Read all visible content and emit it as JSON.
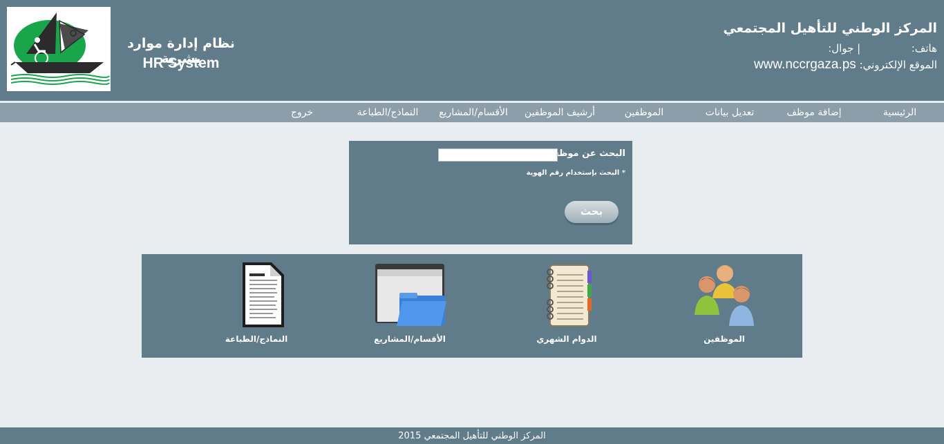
{
  "header": {
    "system_title": "نظام إدارة موارد بشرية",
    "system_subtitle": "HR System",
    "org_name": "المركز الوطني للتأهيل المجتمعي",
    "phone_line": "هاتف:",
    "mobile_line": "| جوال:",
    "website_label": "الموقع الإلكتروني:",
    "website_value": "www.nccrgaza.ps"
  },
  "nav": {
    "items": [
      {
        "label": "الرئيسية"
      },
      {
        "label": "إضافة موظف"
      },
      {
        "label": "تعديل بيانات"
      },
      {
        "label": "الموظفين"
      },
      {
        "label": "أرشيف الموظفين"
      },
      {
        "label": "الأقسام/المشاريع"
      },
      {
        "label": "النماذج/الطباعة"
      },
      {
        "label": "خروج"
      }
    ]
  },
  "search": {
    "label": "البحث عن موظف:",
    "value": "",
    "hint": "* البحث بإستخدام رقم الهوية",
    "button_label": "بحث"
  },
  "shortcuts": {
    "items": [
      {
        "label": "الموظفين",
        "icon": "employees-icon"
      },
      {
        "label": "الدوام الشهري",
        "icon": "notebook-icon"
      },
      {
        "label": "الأقسام/المشاريع",
        "icon": "folder-window-icon"
      },
      {
        "label": "النماذج/الطباعة",
        "icon": "document-icon"
      }
    ]
  },
  "footer": {
    "text": "المركز الوطني للتأهيل المجتمعي 2015"
  },
  "colors": {
    "header_bg": "#607c8b",
    "nav_bg": "#8b9ea9",
    "page_bg": "#eaedf0",
    "logo_green": "#19a54a"
  }
}
